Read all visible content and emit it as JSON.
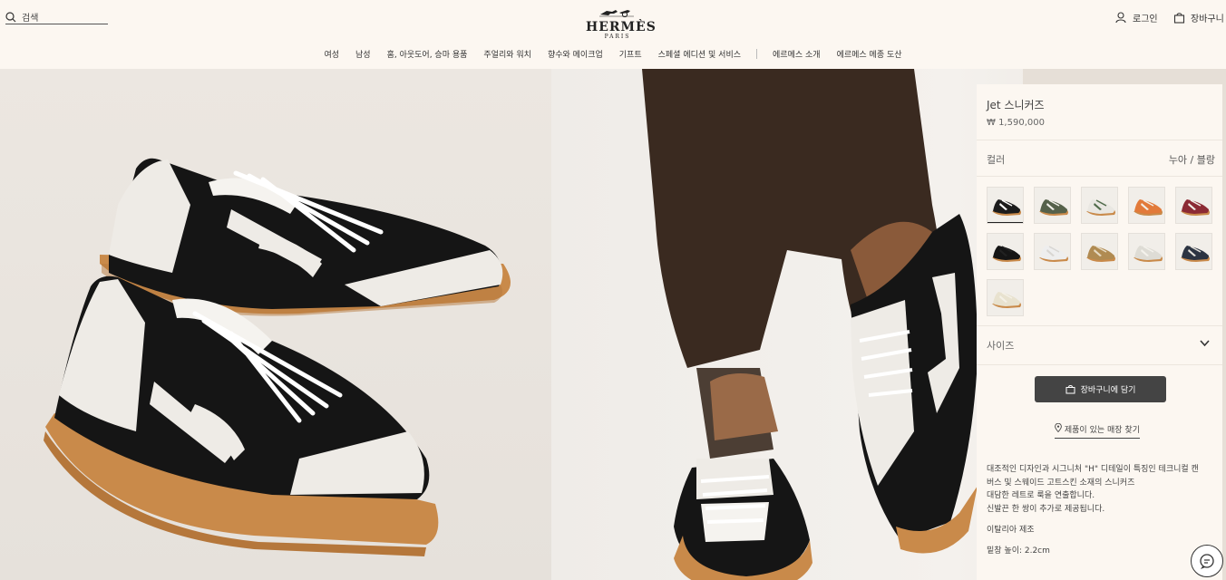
{
  "header": {
    "search_placeholder": "검색",
    "logo_main": "HERMÈS",
    "logo_sub": "PARIS",
    "login_label": "로그인",
    "cart_label": "장바구니"
  },
  "nav": {
    "items": [
      "여성",
      "남성",
      "홈, 아웃도어, 승마 용품",
      "주얼리와 워치",
      "향수와 메이크업",
      "기프트",
      "스페셜 에디션 및 서비스"
    ],
    "items_after_sep": [
      "에르메스 소개",
      "에르메스 메종 도산"
    ]
  },
  "product": {
    "name": "Jet 스니커즈",
    "price": "₩ 1,590,000",
    "color_label": "컬러",
    "color_value": "누아 / 블랑",
    "size_label": "사이즈",
    "add_to_cart": "장바구니에 담기",
    "find_store": "제품이 있는 매장 찾기",
    "description": [
      "대조적인 디자인과 시그니처 \"H\" 디테일이 특징인 테크니컬 캔",
      "버스 및 스웨이드 고트스킨 소재의 스니커즈",
      "대담한 레트로 룩을 연출합니다.",
      "신발끈 한 쌍이 추가로 제공됩니다."
    ],
    "made_in": "이탈리아 제조",
    "sole_height": "밑창 높이: 2.2cm"
  },
  "swatches": [
    {
      "upper": "#1c1c1c",
      "accent": "#ffffff",
      "sole": "#c98a4a"
    },
    {
      "upper": "#55614a",
      "accent": "#f2f0ea",
      "sole": "#c98a4a"
    },
    {
      "upper": "#e9e7e2",
      "accent": "#4f6b4a",
      "sole": "#c98a4a"
    },
    {
      "upper": "#e27a3a",
      "accent": "#f2efe8",
      "sole": "#c98a4a"
    },
    {
      "upper": "#8c2a34",
      "accent": "#f2efe8",
      "sole": "#c98a4a"
    },
    {
      "upper": "#151515",
      "accent": "#222222",
      "sole": "#c98a4a"
    },
    {
      "upper": "#eeeeee",
      "accent": "#d8d6d2",
      "sole": "#c98a4a"
    },
    {
      "upper": "#b08b52",
      "accent": "#e6dac2",
      "sole": "#c98a4a"
    },
    {
      "upper": "#dedcd5",
      "accent": "#f4f2ec",
      "sole": "#c98a4a"
    },
    {
      "upper": "#2c3442",
      "accent": "#e6e3dc",
      "sole": "#c98a4a"
    },
    {
      "upper": "#e8e2cf",
      "accent": "#f4f0e6",
      "sole": "#c98a4a"
    }
  ],
  "colors": {
    "background": "#fcf7f1",
    "button": "#444444",
    "sole": "#c98a4a"
  }
}
